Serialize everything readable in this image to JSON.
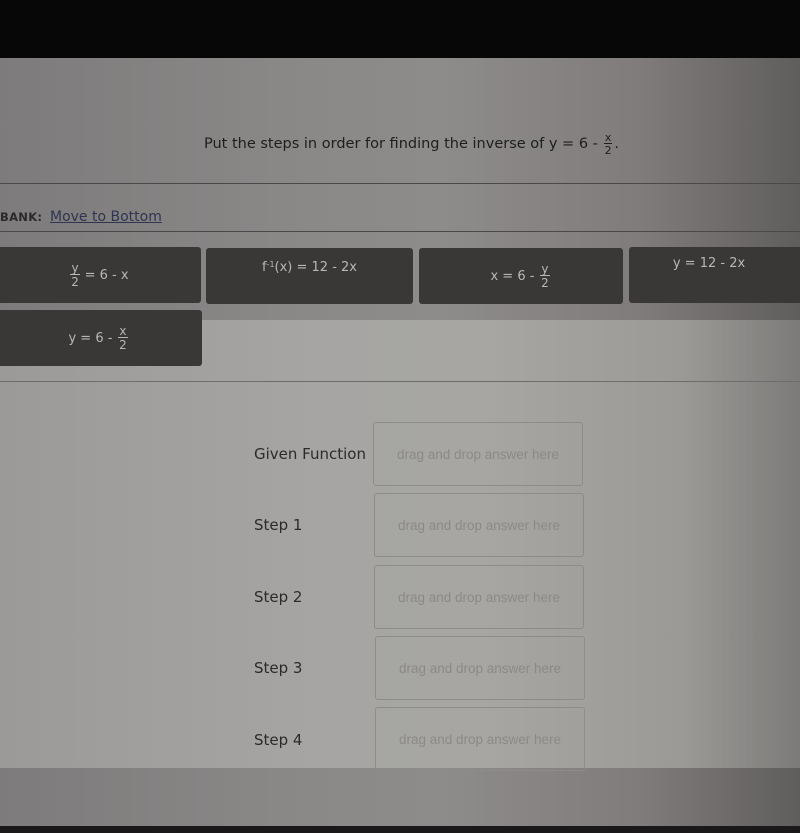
{
  "question": {
    "prefix": "Put the steps in order for finding the inverse of y = 6 -",
    "fraction_num": "x",
    "fraction_den": "2",
    "suffix": "."
  },
  "answer_bank": {
    "label": "BANK:",
    "move_link": "Move to Bottom",
    "tiles": [
      {
        "id": "tile-y-over-2",
        "pre": "",
        "frac_num": "y",
        "frac_den": "2",
        "post": "= 6 - x"
      },
      {
        "id": "tile-inverse",
        "func": "f",
        "sup": "-1",
        "text": "(x) = 12 - 2x"
      },
      {
        "id": "tile-x-equals",
        "pre": "x = 6 -",
        "frac_num": "y",
        "frac_den": "2",
        "post": ""
      },
      {
        "id": "tile-y-12",
        "text": "y = 12 - 2x"
      },
      {
        "id": "tile-given",
        "pre": "y = 6 -",
        "frac_num": "x",
        "frac_den": "2",
        "post": ""
      }
    ]
  },
  "steps": [
    {
      "label": "Given Function",
      "placeholder": "drag and drop answer here"
    },
    {
      "label": "Step 1",
      "placeholder": "drag and drop answer here"
    },
    {
      "label": "Step 2",
      "placeholder": "drag and drop answer here"
    },
    {
      "label": "Step 3",
      "placeholder": "drag and drop answer here"
    },
    {
      "label": "Step 4",
      "placeholder": "drag and drop answer here"
    }
  ]
}
